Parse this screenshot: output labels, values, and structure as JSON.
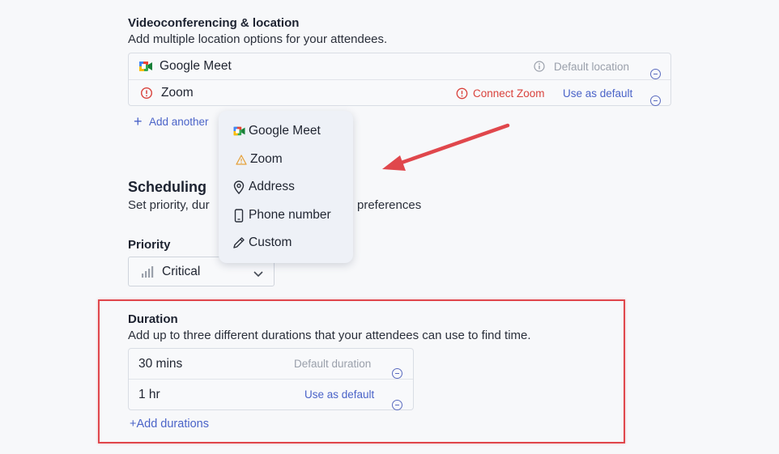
{
  "location": {
    "title": "Videoconferencing & location",
    "subtitle": "Add multiple location options for your attendees.",
    "options": [
      {
        "label": "Google Meet",
        "icon": "google-meet-icon",
        "status": "Default location",
        "status_icon": "info-icon"
      },
      {
        "label": "Zoom",
        "icon": "alert-circle-icon",
        "warning": "Connect Zoom",
        "action": "Use as default"
      }
    ],
    "add_label": "Add another"
  },
  "menu": {
    "items": [
      {
        "label": "Google Meet",
        "icon": "google-meet-icon"
      },
      {
        "label": "Zoom",
        "icon": "warning-triangle-icon"
      },
      {
        "label": "Address",
        "icon": "map-pin-icon"
      },
      {
        "label": "Phone number",
        "icon": "phone-icon"
      },
      {
        "label": "Custom",
        "icon": "pencil-icon"
      }
    ]
  },
  "scheduling": {
    "title": "Scheduling",
    "subtitle_left": "Set priority, dur",
    "subtitle_right": "preferences"
  },
  "priority": {
    "label": "Priority",
    "value": "Critical",
    "icon": "signal-bars-icon"
  },
  "duration": {
    "title": "Duration",
    "subtitle": "Add up to three different durations that your attendees can use to find time.",
    "options": [
      {
        "label": "30 mins",
        "status": "Default duration"
      },
      {
        "label": "1 hr",
        "action": "Use as default"
      }
    ],
    "add_label": "+Add durations"
  },
  "colors": {
    "accent": "#4a63c8",
    "error": "#d9423c",
    "highlight": "#e0474c",
    "arrow": "#e0474c",
    "background": "#f7f8fa"
  }
}
